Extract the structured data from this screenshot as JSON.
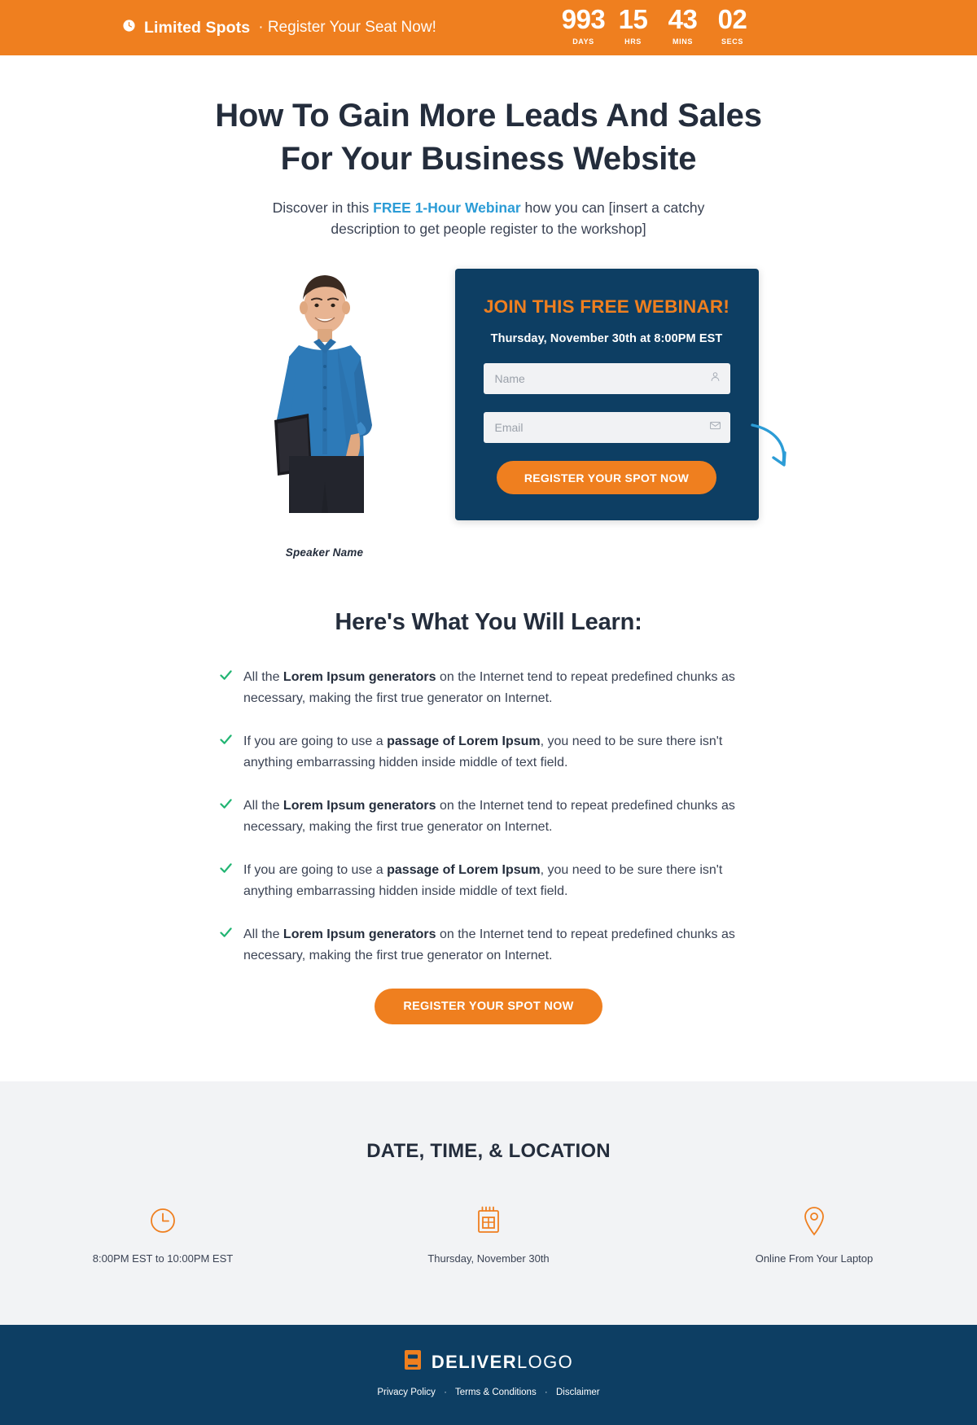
{
  "countdown": {
    "icon": "clock-icon",
    "notice_strong": "Limited Spots",
    "notice_rest": "· Register Your Seat Now!",
    "units": [
      {
        "value": "993",
        "label": "DAYS"
      },
      {
        "value": "15",
        "label": "HRS"
      },
      {
        "value": "43",
        "label": "MINS"
      },
      {
        "value": "02",
        "label": "SECS"
      }
    ],
    "bg_color": "#ef7f1f"
  },
  "hero": {
    "headline_line1": "How To Gain More Leads And Sales",
    "headline_line2": "For Your Business Website",
    "sub_before": "Discover in this ",
    "sub_highlight": "FREE 1-Hour Webinar",
    "sub_after": " how you can [insert a catchy description to get people register to the workshop]",
    "highlight_color": "#2c9cd6"
  },
  "speaker": {
    "caption": "Speaker Name",
    "photo_alt": "speaker-photo"
  },
  "form": {
    "title": "JOIN THIS FREE WEBINAR!",
    "date_line": "Thursday, November 30th at 8:00PM EST",
    "name_placeholder": "Name",
    "name_value": "",
    "name_icon": "user-icon",
    "email_placeholder": "Email",
    "email_value": "",
    "email_icon": "envelope-icon",
    "submit_label": "REGISTER YOUR SPOT NOW",
    "card_color": "#0d3e63",
    "accent_color": "#ef7f1f",
    "arrow_icon": "curved-arrow-icon",
    "arrow_color": "#2c9cd6"
  },
  "learn": {
    "title": "Here's What You Will Learn:",
    "check_color": "#22b573",
    "bullets": [
      {
        "pre": "All the ",
        "bold": "Lorem Ipsum generators",
        "post": " on the Internet tend to repeat predefined chunks as necessary, making the first true generator on Internet."
      },
      {
        "pre": "If you are going to use a ",
        "bold": "passage of Lorem Ipsum",
        "post": ", you need to be sure there isn't anything embarrassing hidden inside middle of text field."
      },
      {
        "pre": "All the ",
        "bold": "Lorem Ipsum generators",
        "post": " on the Internet tend to repeat predefined chunks as necessary, making the first true generator on Internet."
      },
      {
        "pre": "If you are going to use a ",
        "bold": "passage of Lorem Ipsum",
        "post": ", you need to be sure there isn't anything embarrassing hidden inside middle of text field."
      },
      {
        "pre": "All the ",
        "bold": "Lorem Ipsum generators",
        "post": " on the Internet tend to repeat predefined chunks as necessary, making the first true generator on Internet."
      }
    ],
    "cta_label": "REGISTER YOUR SPOT NOW"
  },
  "info": {
    "title": "DATE, TIME, & LOCATION",
    "icon_color": "#ef7f1f",
    "columns": [
      {
        "icon": "clock-icon",
        "label": "8:00PM EST to 10:00PM EST"
      },
      {
        "icon": "calendar-icon",
        "label": "Thursday, November 30th"
      },
      {
        "icon": "map-pin-icon",
        "label": "Online From Your Laptop"
      }
    ]
  },
  "footer": {
    "logo_icon": "book-logo-icon",
    "logo_bold": "DELIVER",
    "logo_light": "LOGO",
    "links": [
      "Privacy Policy",
      "Terms & Conditions",
      "Disclaimer"
    ],
    "separator": "·",
    "bg_color": "#0d3e63"
  }
}
